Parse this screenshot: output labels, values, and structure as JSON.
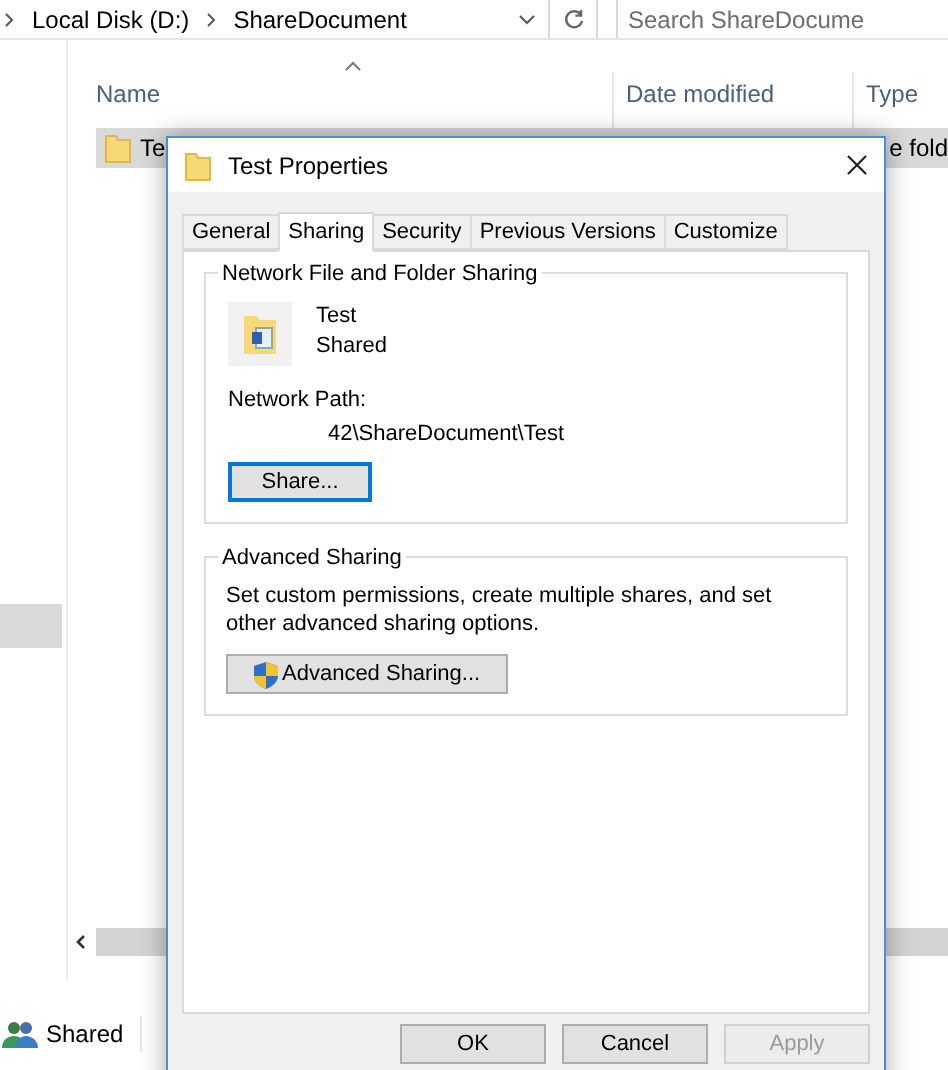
{
  "explorer": {
    "breadcrumb": [
      "Local Disk (D:)",
      "ShareDocument"
    ],
    "search": {
      "placeholder": "Search ShareDocume"
    },
    "columns": [
      "Name",
      "Date modified",
      "Type"
    ],
    "rows": [
      {
        "name": "Te",
        "type": "e fold",
        "selected": true
      }
    ],
    "status_bar": {
      "label": "Shared"
    }
  },
  "dialog": {
    "title": "Test Properties",
    "tabs": [
      {
        "label": "General",
        "selected": false
      },
      {
        "label": "Sharing",
        "selected": true
      },
      {
        "label": "Security",
        "selected": false
      },
      {
        "label": "Previous Versions",
        "selected": false
      },
      {
        "label": "Customize",
        "selected": false
      }
    ],
    "network_sharing": {
      "heading": "Network File and Folder Sharing",
      "folder_name": "Test",
      "status": "Shared",
      "path_label": "Network Path:",
      "path": "42\\ShareDocument\\Test",
      "button": {
        "label": "Share...",
        "focused": true
      }
    },
    "advanced_sharing": {
      "heading": "Advanced Sharing",
      "description": "Set custom permissions, create multiple shares, and set other advanced sharing options.",
      "button": {
        "label": "Advanced Sharing..."
      }
    },
    "buttons": [
      {
        "label": "OK",
        "disabled": false
      },
      {
        "label": "Cancel",
        "disabled": false
      },
      {
        "label": "Apply",
        "disabled": true
      }
    ]
  }
}
